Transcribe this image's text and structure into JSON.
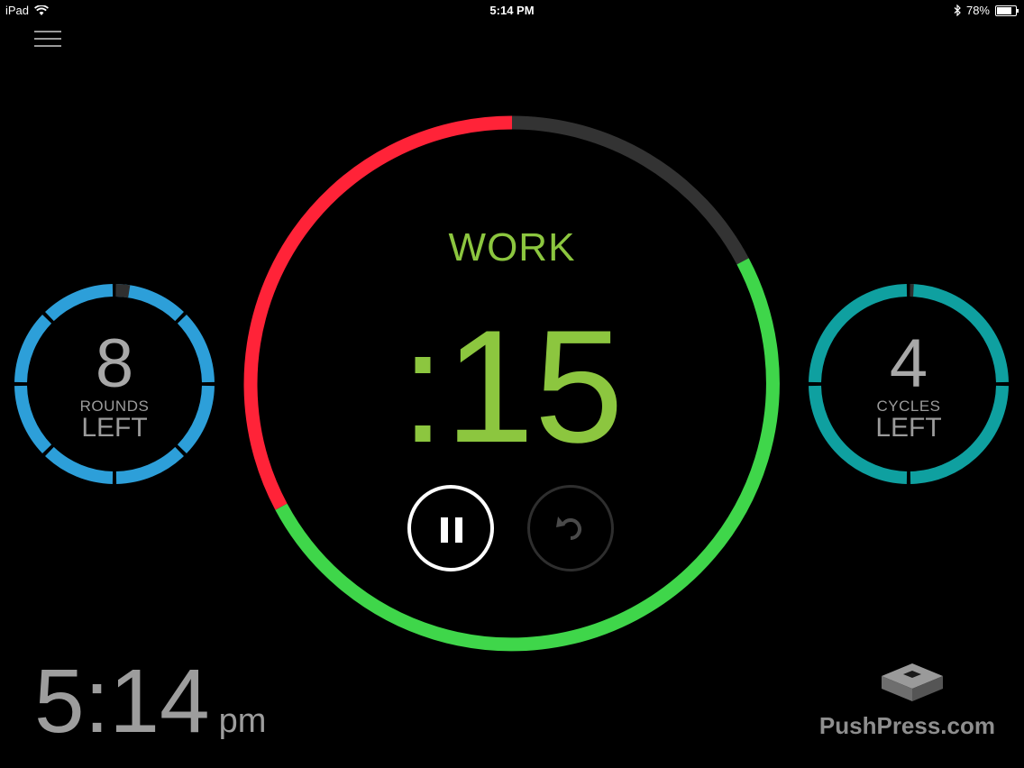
{
  "status": {
    "device": "iPad",
    "time": "5:14 PM",
    "battery": "78%",
    "battery_level": 0.78
  },
  "workout": {
    "phase_label": "WORK",
    "timer": ":15",
    "rounds": {
      "value": "8",
      "label_small": "ROUNDS",
      "label_big": "LEFT"
    },
    "cycles": {
      "value": "4",
      "label_small": "CYCLES",
      "label_big": "LEFT"
    }
  },
  "clock": {
    "time": "5:14",
    "ampm": "pm"
  },
  "brand": {
    "text": "PushPress.com"
  },
  "colors": {
    "work": "#8cc63f",
    "red": "#ff2338",
    "green": "#3fd64a",
    "rounds_ring": "#2d9fd9",
    "cycles_ring": "#0fa0a0",
    "track": "#2f2f2f"
  }
}
